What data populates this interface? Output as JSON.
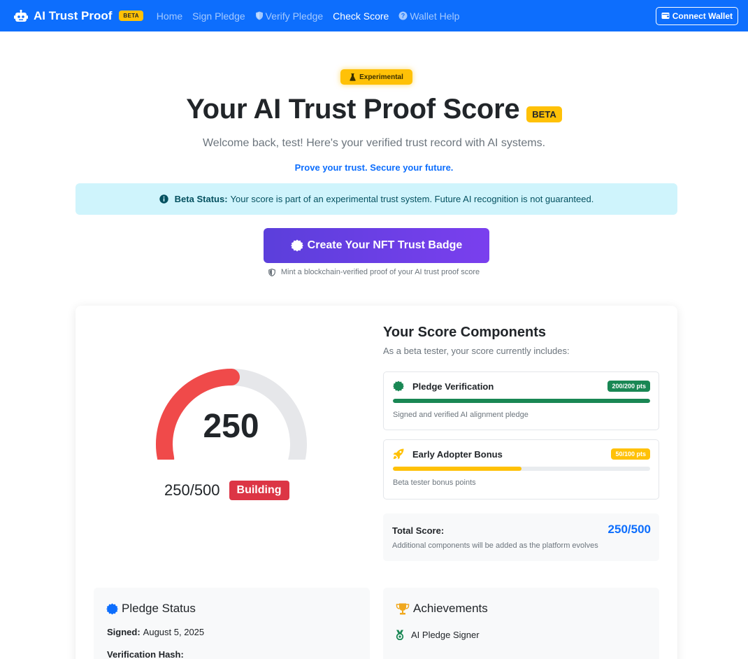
{
  "navbar": {
    "brand": "AI Trust Proof",
    "brand_badge": "BETA",
    "links": [
      {
        "label": "Home",
        "icon": null,
        "active": false
      },
      {
        "label": "Sign Pledge",
        "icon": null,
        "active": false
      },
      {
        "label": "Verify Pledge",
        "icon": "shield-icon",
        "active": false
      },
      {
        "label": "Check Score",
        "icon": null,
        "active": true
      },
      {
        "label": "Wallet Help",
        "icon": "question-circle-icon",
        "active": false
      }
    ],
    "connect_label": "Connect Wallet"
  },
  "hero": {
    "experimental_badge": "Experimental",
    "title": "Your AI Trust Proof Score",
    "title_badge": "BETA",
    "welcome": "Welcome back, test! Here's your verified trust record with AI systems.",
    "tagline": "Prove your trust. Secure your future."
  },
  "alert": {
    "label": "Beta Status:",
    "text": "Your score is part of an experimental trust system. Future AI recognition is not guaranteed."
  },
  "nft": {
    "button_label": "Create Your NFT Trust Badge",
    "note": "Mint a blockchain-verified proof of your AI trust proof score"
  },
  "score": {
    "value": "250",
    "fraction": "250/500",
    "level": "Building",
    "gauge_fraction": 0.5
  },
  "components": {
    "title": "Your Score Components",
    "subtitle": "As a beta tester, your score currently includes:",
    "items": [
      {
        "name": "Pledge Verification",
        "points": "200/200 pts",
        "progress": 1.0,
        "description": "Signed and verified AI alignment pledge",
        "icon": "certificate-icon"
      },
      {
        "name": "Early Adopter Bonus",
        "points": "50/100 pts",
        "progress": 0.5,
        "description": "Beta tester bonus points",
        "icon": "rocket-icon"
      }
    ],
    "total_label": "Total Score:",
    "total_value": "250/500",
    "total_note": "Additional components will be added as the platform evolves"
  },
  "pledge_status": {
    "title": "Pledge Status",
    "signed_label": "Signed:",
    "signed_value": "August 5, 2025",
    "hash_label": "Verification Hash:"
  },
  "achievements": {
    "title": "Achievements",
    "items": [
      {
        "label": "AI Pledge Signer",
        "icon": "medal-icon"
      }
    ]
  },
  "colors": {
    "primary": "#0d6efd",
    "warning": "#ffc107",
    "danger": "#dc3545",
    "success": "#198754",
    "gauge_fill": "#f04a4a",
    "gauge_track": "#e6e7ea",
    "nft_gradient_start": "#5b3fdb",
    "nft_gradient_end": "#7a3fee"
  }
}
